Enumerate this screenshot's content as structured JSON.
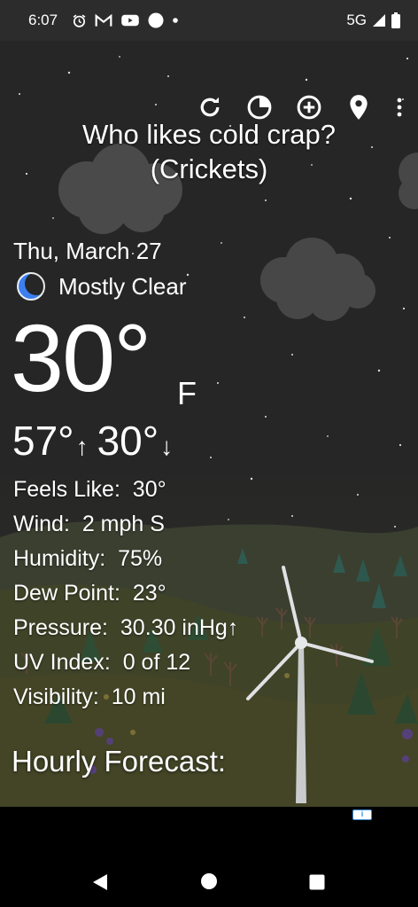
{
  "status_bar": {
    "time": "6:07",
    "icons": [
      "alarm-icon",
      "gmail-icon",
      "youtube-icon",
      "circle-icon",
      "dot-icon"
    ],
    "network": "5G"
  },
  "toolbar": {
    "buttons": [
      "refresh-icon",
      "radar-icon",
      "add-location-icon",
      "location-pin-icon",
      "more-vert-icon"
    ]
  },
  "quip": {
    "line1": "Who likes cold crap?",
    "line2": "(Crickets)"
  },
  "current": {
    "date": "Thu, March 27",
    "condition": "Mostly Clear",
    "condition_icon": "moon-icon",
    "temperature": "30°",
    "unit": "F",
    "high": "57°",
    "low": "30°"
  },
  "details": [
    {
      "label": "Feels Like:",
      "value": "30°"
    },
    {
      "label": "Wind:",
      "value": "2 mph S"
    },
    {
      "label": "Humidity:",
      "value": "75%"
    },
    {
      "label": "Dew Point:",
      "value": "23°"
    },
    {
      "label": "Pressure:",
      "value": "30.30 inHg↑"
    },
    {
      "label": "UV Index:",
      "value": "0 of 12"
    },
    {
      "label": "Visibility:",
      "value": "10 mi"
    }
  ],
  "hourly": {
    "title": "Hourly Forecast:"
  },
  "ad": {
    "badge": "i"
  },
  "colors": {
    "accent_moon": "#3b7ff0",
    "status_bg": "#2c2c2c",
    "sky": "#262626"
  }
}
